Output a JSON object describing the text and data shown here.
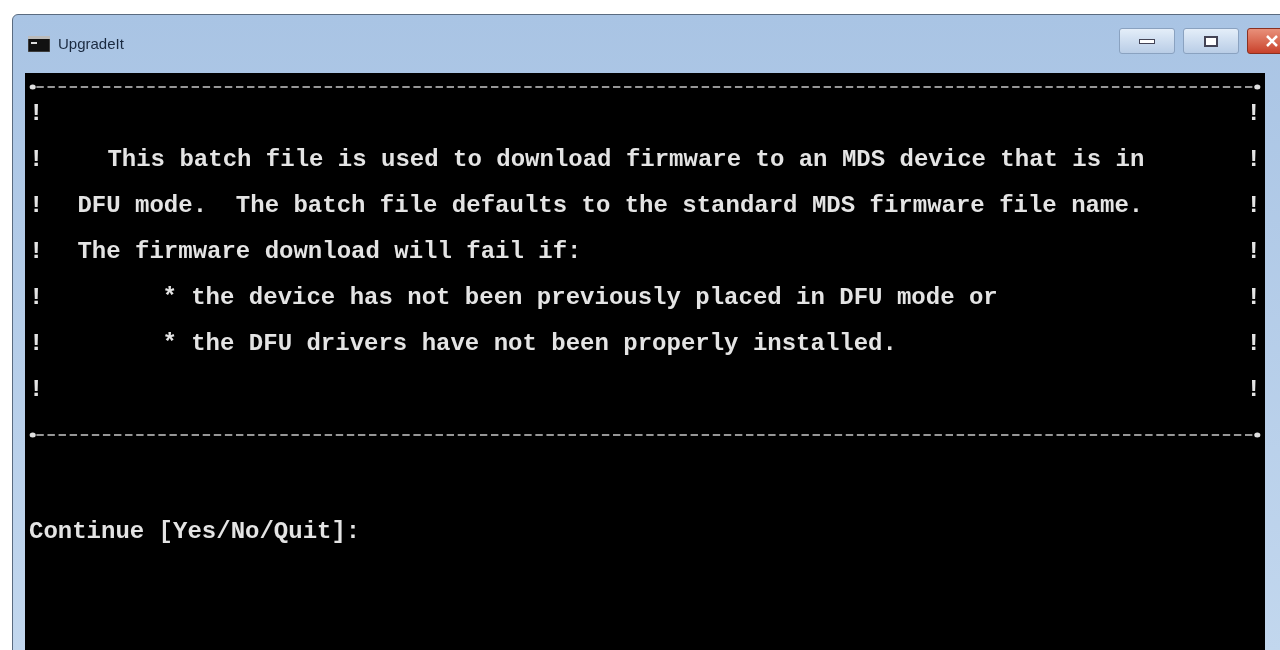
{
  "window": {
    "title": "UpgradeIt"
  },
  "console": {
    "border_char": "!",
    "box_lines": [
      {
        "kind": "blank"
      },
      {
        "kind": "para-start",
        "text": "This batch file is used to download firmware to an MDS device that is in"
      },
      {
        "kind": "para",
        "text": "DFU mode.  The batch file defaults to the standard MDS firmware file name."
      },
      {
        "kind": "para",
        "text": "The firmware download will fail if:"
      },
      {
        "kind": "bullet",
        "text": "* the device has not been previously placed in DFU mode or"
      },
      {
        "kind": "bullet",
        "text": "* the DFU drivers have not been properly installed."
      },
      {
        "kind": "blank"
      }
    ],
    "prompt": "Continue [Yes/No/Quit]:"
  }
}
